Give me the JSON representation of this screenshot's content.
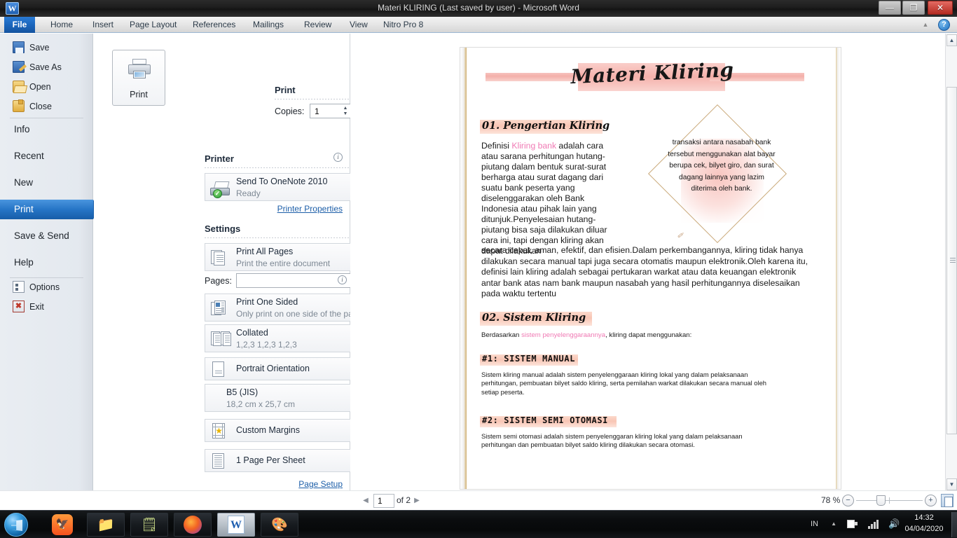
{
  "window": {
    "title": "Materi KLIRING (Last saved by user)  -  Microsoft Word",
    "logo_text": "W",
    "minimize_glyph": "—",
    "maximize_glyph": "❐",
    "close_glyph": "✕",
    "collapse_ribbon_glyph": "▲",
    "help_glyph": "?"
  },
  "ribbon": {
    "tabs": [
      {
        "label": "File"
      },
      {
        "label": "Home"
      },
      {
        "label": "Insert"
      },
      {
        "label": "Page Layout"
      },
      {
        "label": "References"
      },
      {
        "label": "Mailings"
      },
      {
        "label": "Review"
      },
      {
        "label": "View"
      },
      {
        "label": "Nitro Pro 8"
      }
    ]
  },
  "backstage_nav": {
    "items": [
      {
        "label": "Save",
        "icon": "save-icon"
      },
      {
        "label": "Save As",
        "icon": "save-as-icon"
      },
      {
        "label": "Open",
        "icon": "open-folder-icon"
      },
      {
        "label": "Close",
        "icon": "close-folder-icon"
      },
      {
        "label": "Info",
        "icon": ""
      },
      {
        "label": "Recent",
        "icon": ""
      },
      {
        "label": "New",
        "icon": ""
      },
      {
        "label": "Print",
        "icon": ""
      },
      {
        "label": "Save & Send",
        "icon": ""
      },
      {
        "label": "Help",
        "icon": ""
      },
      {
        "label": "Options",
        "icon": "options-icon"
      },
      {
        "label": "Exit",
        "icon": "exit-icon"
      }
    ],
    "selected": "Print"
  },
  "print_panel": {
    "print_button_label": "Print",
    "print_heading": "Print",
    "copies_label": "Copies:",
    "copies_value": "1",
    "printer_heading": "Printer",
    "printer_name": "Send To OneNote 2010",
    "printer_status": "Ready",
    "printer_properties_link": "Printer Properties",
    "settings_heading": "Settings",
    "pages_label": "Pages:",
    "pages_value": "",
    "page_setup_link": "Page Setup",
    "info_glyph": "i",
    "settings": [
      {
        "title": "Print All Pages",
        "sub": "Print the entire document",
        "icon": "all-pages-icon"
      },
      {
        "title": "Print One Sided",
        "sub": "Only print on one side of the page",
        "icon": "one-sided-icon"
      },
      {
        "title": "Collated",
        "sub": "1,2,3   1,2,3   1,2,3",
        "icon": "collated-icon"
      },
      {
        "title": "Portrait Orientation",
        "sub": "",
        "icon": "portrait-icon"
      },
      {
        "title": "B5 (JIS)",
        "sub": "18,2 cm x 25,7 cm",
        "icon": "paper-size-icon"
      },
      {
        "title": "Custom Margins",
        "sub": "",
        "icon": "margins-icon"
      },
      {
        "title": "1 Page Per Sheet",
        "sub": "",
        "icon": "pages-per-sheet-icon"
      }
    ]
  },
  "document": {
    "title": "Materi Kliring",
    "heading_01": "01. Pengertian Kliring",
    "body_intro_pre": "Definisi ",
    "body_intro_highlight": "Kliring bank",
    "body_intro_post": " adalah cara atau sarana perhitungan hutang-piutang dalam bentuk surat-surat berharga atau surat dagang dari suatu bank peserta yang diselenggarakan oleh Bank Indonesia atau pihak lain yang ditunjuk.Penyelesaian hutang-piutang bisa saja dilakukan diluar cara ini, tapi dengan kliring akan dapat dilakukan",
    "body_rest": "secara cepat, aman, efektif, dan efisien.Dalam perkembangannya, kliring tidak hanya dilakukan secara manual tapi juga secara otomatis maupun elektronik.Oleh karena itu, definisi lain kliring adalah sebagai pertukaran warkat atau data keuangan elektronik antar bank atas nam bank maupun nasabah yang hasil perhitungannya diselesaikan pada waktu tertentu",
    "diamond_text": "transaksi antara nasabah bank tersebut menggunakan alat bayar berupa cek, bilyet giro, dan surat dagang lainnya yang lazim diterima oleh bank.",
    "diamond_signature": "✐",
    "heading_02": "02. Sistem Kliring",
    "sub_02_pre": "Berdasarkan ",
    "sub_02_highlight": "sistem penyelenggaraannya",
    "sub_02_post": ",  kliring  dapat menggunakan:",
    "heading_manual": "#1:  SISTEM MANUAL",
    "body_manual": "Sistem kliring  manual adalah sistem penyelenggaraan kliring lokal  yang dalam pelaksanaan perhitungan, pembuatan bilyet saldo kliring,  serta pemilahan warkat dilakukan secara manual oleh setiap peserta.",
    "heading_semi": "#2:  SISTEM SEMI OTOMASI",
    "body_semi": "Sistem semi otomasi  adalah sistem penyelenggaran kliring  lokal yang dalam pelaksanaan perhitungan dan pembuatan bilyet saldo kliring  dilakukan secara otomasi."
  },
  "statusbar": {
    "page_number": "1",
    "page_of": "of 2",
    "prev_glyph": "◀",
    "next_glyph": "▶",
    "zoom_percent": "78 %",
    "zoom_out_glyph": "−",
    "zoom_in_glyph": "+"
  },
  "taskbar": {
    "items": [
      {
        "name": "uc-browser",
        "glyph": "🦅"
      },
      {
        "name": "file-explorer",
        "glyph": "📁"
      },
      {
        "name": "sticky-notes",
        "glyph": "🗒"
      },
      {
        "name": "firefox",
        "glyph": "🦊"
      },
      {
        "name": "word",
        "glyph": "W"
      },
      {
        "name": "paint",
        "glyph": "🎨"
      }
    ],
    "tray": {
      "language": "IN",
      "show_hidden_glyph": "▲",
      "volume_glyph": "🔊",
      "time": "14:32",
      "date": "04/04/2020"
    }
  },
  "colors": {
    "accent_blue": "#1b66bd",
    "pink_highlight": "#f07ab4",
    "banner_pink": "#f2a9a2",
    "close_red": "#b32a20"
  }
}
